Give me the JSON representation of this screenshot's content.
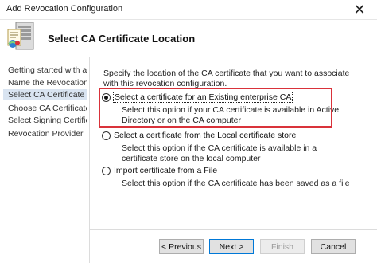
{
  "window": {
    "title": "Add Revocation Configuration",
    "close_glyph": "✕"
  },
  "header": {
    "title": "Select CA Certificate Location",
    "icon": "certificate-server-icon"
  },
  "sidebar": {
    "items": [
      {
        "label": "Getting started with addi..."
      },
      {
        "label": "Name the Revocation Co..."
      },
      {
        "label": "Select CA Certificate Loca...",
        "selected": true
      },
      {
        "label": "Choose CA Certificate"
      },
      {
        "label": "Select Signing Certificate"
      },
      {
        "label": "Revocation Provider"
      }
    ]
  },
  "main": {
    "intro": "Specify the location of the CA certificate that you want to associate with this revocation configuration.",
    "options": [
      {
        "label": "Select a certificate for an Existing enterprise CA",
        "description": "Select this option if your CA certificate is available in Active Directory or on the CA computer",
        "checked": true
      },
      {
        "label": "Select a certificate from the Local certificate store",
        "description": "Select this option if the CA certificate is available in a certificate store on the local computer",
        "checked": false
      },
      {
        "label": "Import certificate from a File",
        "description": "Select this option if the CA certificate has been saved as a file",
        "checked": false
      }
    ]
  },
  "footer": {
    "previous_label": "< Previous",
    "next_label": "Next >",
    "finish_label": "Finish",
    "cancel_label": "Cancel"
  },
  "colors": {
    "highlight_border": "#d9323a",
    "sidebar_selected_bg": "#d9e4f1",
    "default_button_border": "#0078d7"
  }
}
